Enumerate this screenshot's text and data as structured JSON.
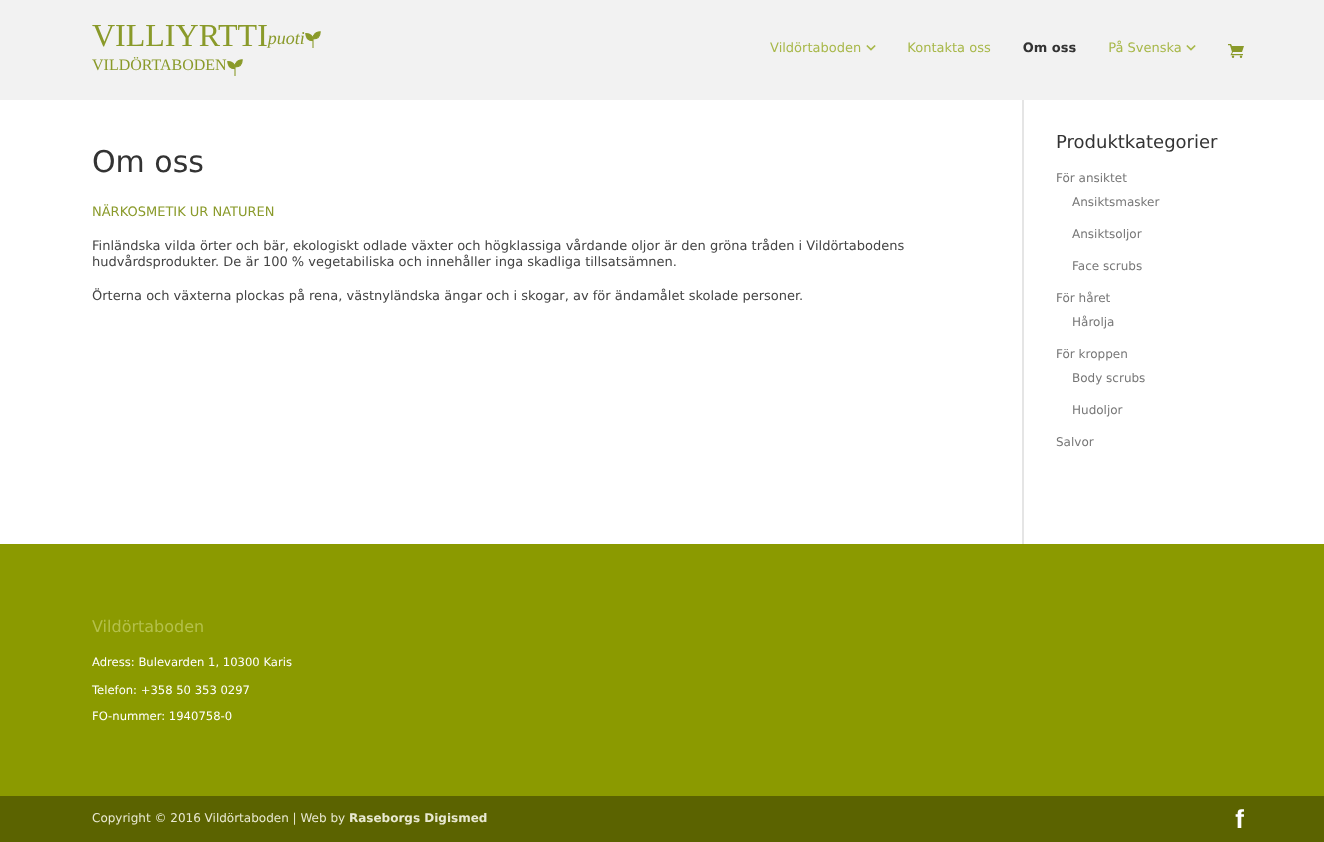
{
  "logo": {
    "title": "VILLIYRTTI",
    "suffix": "puoti",
    "subtitle": "VILDÖRTABODEN"
  },
  "nav": [
    {
      "label": "Vildörtaboden",
      "dropdown": true,
      "selected": false
    },
    {
      "label": "Kontakta oss",
      "dropdown": false,
      "selected": false
    },
    {
      "label": "Om oss",
      "dropdown": false,
      "selected": true
    },
    {
      "label": "På Svenska",
      "dropdown": true,
      "selected": false
    }
  ],
  "page": {
    "title": "Om oss",
    "subtitle": "NÄRKOSMETIK UR NATUREN",
    "paragraphs": [
      "Finländska vilda örter och bär, ekologiskt odlade växter och högklassiga vårdande oljor är den gröna tråden i Vildörtabodens hudvårdsprodukter. De är 100 % vegetabiliska och innehåller inga skadliga tillsatsämnen.",
      "Örterna och växterna plockas på rena, västnyländska ängar och i skogar, av för ändamålet skolade personer."
    ]
  },
  "sidebar": {
    "title": "Produktkategorier",
    "items": [
      {
        "label": "För ansiktet",
        "children": [
          {
            "label": "Ansiktsmasker"
          },
          {
            "label": "Ansiktsoljor"
          },
          {
            "label": "Face scrubs"
          }
        ]
      },
      {
        "label": "För håret",
        "children": [
          {
            "label": "Hårolja"
          }
        ]
      },
      {
        "label": "För kroppen",
        "children": [
          {
            "label": "Body scrubs"
          },
          {
            "label": "Hudoljor"
          }
        ]
      },
      {
        "label": "Salvor"
      }
    ]
  },
  "footer": {
    "title": "Vildörtaboden",
    "lines": [
      "Adress: Bulevarden 1, 10300 Karis",
      "Telefon: +358 50 353 0297",
      "FO-nummer: 1940758-0"
    ]
  },
  "bottom_bar": {
    "copyright": "Copyright © 2016 Vildörtaboden | Web by **Raseborgs Digismed**",
    "social": "f"
  }
}
